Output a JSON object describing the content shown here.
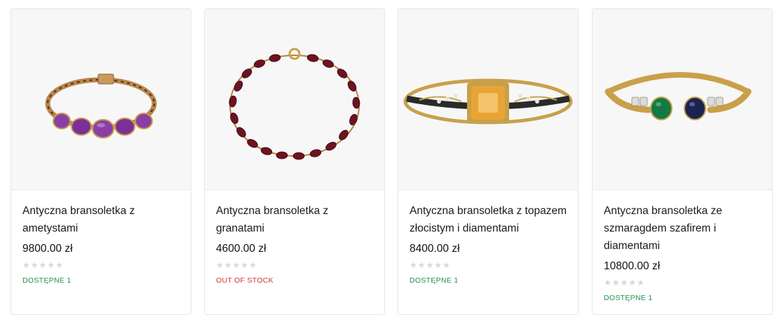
{
  "products": [
    {
      "title": "Antyczna bransoletka z ametystami",
      "price": "9800.00 zł",
      "rating": 0,
      "stock": "DOSTĘPNE  1",
      "in_stock": true,
      "image_alt": "bracelet-amethyst-icon",
      "gem_color": "#8b3fa6"
    },
    {
      "title": "Antyczna bransoletka z granatami",
      "price": "4600.00 zł",
      "rating": 0,
      "stock": "OUT OF STOCK",
      "in_stock": false,
      "image_alt": "bracelet-garnet-icon",
      "gem_color": "#6e1320"
    },
    {
      "title": "Antyczna bransoletka z topazem złocistym i diamentami",
      "price": "8400.00 zł",
      "rating": 0,
      "stock": "DOSTĘPNE  1",
      "in_stock": true,
      "image_alt": "bracelet-topaz-icon",
      "gem_color": "#e8a536"
    },
    {
      "title": "Antyczna bransoletka ze szmaragdem szafirem i diamentami",
      "price": "10800.00 zł",
      "rating": 0,
      "stock": "DOSTĘPNE  1",
      "in_stock": true,
      "image_alt": "bracelet-emerald-sapphire-icon",
      "gem_color": "#137a45"
    }
  ],
  "colors": {
    "in_stock": "#1f8f4f",
    "out_of_stock": "#d0352c",
    "star_empty": "#d7d7d7",
    "gold": "#c9a04a"
  }
}
